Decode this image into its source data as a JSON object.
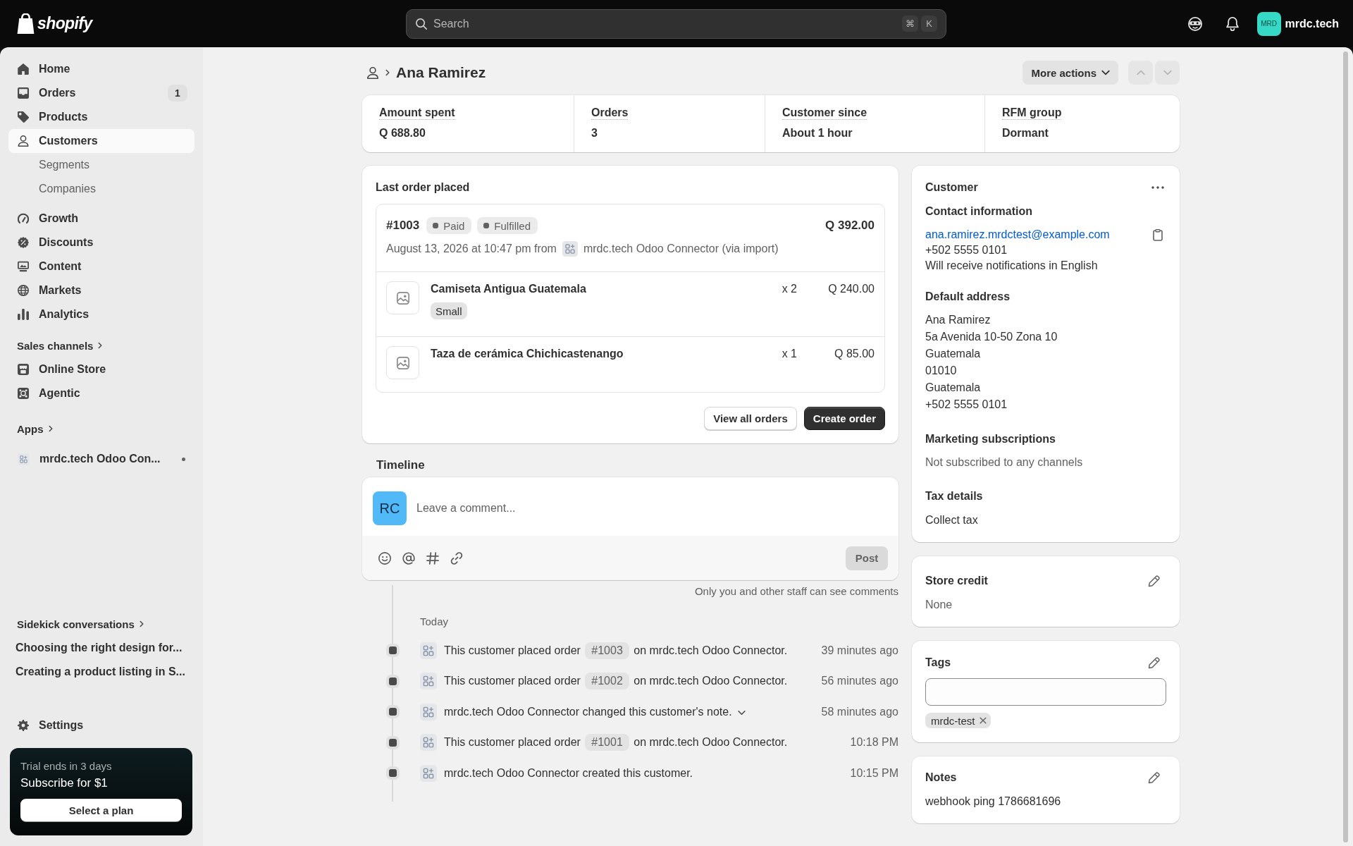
{
  "top_bar": {
    "logo": "shopify",
    "search": {
      "placeholder": "Search",
      "keys": [
        "⌘",
        "K"
      ]
    },
    "store": {
      "avatar": "MRD",
      "name": "mrdc.tech"
    }
  },
  "sidebar": {
    "nav": [
      {
        "label": "Home",
        "selected": false
      },
      {
        "label": "Orders",
        "selected": false,
        "badge": "1"
      },
      {
        "label": "Products",
        "selected": false
      },
      {
        "label": "Customers",
        "selected": true,
        "children": [
          {
            "label": "Segments",
            "selected": false
          },
          {
            "label": "Companies",
            "selected": false
          }
        ]
      }
    ],
    "nav_2": [
      {
        "label": "Growth",
        "selected": false
      },
      {
        "label": "Discounts",
        "selected": false
      },
      {
        "label": "Content",
        "selected": false
      },
      {
        "label": "Markets",
        "selected": false
      },
      {
        "label": "Analytics",
        "selected": false
      }
    ],
    "sales_channels": {
      "title": "Sales channels",
      "items": [
        {
          "label": "Online Store",
          "selected": false
        },
        {
          "label": "Agentic",
          "selected": false
        }
      ]
    },
    "apps": {
      "title": "Apps",
      "items": [
        {
          "label": "mrdc.tech Odoo Con...",
          "selected": false
        }
      ]
    },
    "sidekick": {
      "title": "Sidekick conversations",
      "items": [
        {
          "label": "Choosing the right design for...",
          "selected": false
        },
        {
          "label": "Creating a product listing in S...",
          "selected": false
        }
      ]
    },
    "settings": {
      "label": "Settings",
      "selected": false
    },
    "trial": {
      "note": "Trial ends in 3 days",
      "title": "Subscribe for $1",
      "button": "Select a plan"
    }
  },
  "page": {
    "title": "Ana Ramirez",
    "more_actions": "More actions",
    "pager": [
      {
        "kind": "previous",
        "disabled": true
      },
      {
        "kind": "next",
        "disabled": true
      }
    ]
  },
  "stats": [
    {
      "label": "Amount spent",
      "value": "Q 688.80"
    },
    {
      "label": "Orders",
      "value": "3"
    },
    {
      "label": "Customer since",
      "value": "About 1 hour"
    },
    {
      "label": "RFM group",
      "value": "Dormant"
    }
  ],
  "last_order": {
    "title": "Last order placed",
    "number": "#1003",
    "statuses": [
      "Paid",
      "Fulfilled"
    ],
    "total": "Q 392.00",
    "date": "August 13, 2026 at 10:47 pm from",
    "source": "mrdc.tech Odoo Connector (via import)",
    "line_items": [
      {
        "name": "Camiseta Antigua Guatemala",
        "variant": "Small",
        "quantity": "x 2",
        "price": "Q 240.00"
      },
      {
        "name": "Taza de cerámica Chichicastenango",
        "quantity": "x 1",
        "price": "Q 85.00"
      }
    ],
    "buttons": [
      {
        "label": "View all orders",
        "kind": "secondary"
      },
      {
        "label": "Create order",
        "kind": "primary"
      }
    ]
  },
  "timeline": {
    "title": "Timeline",
    "comment": {
      "avatar": "RC",
      "placeholder": "Leave a comment...",
      "post": {
        "label": "Post",
        "disabled": true
      }
    },
    "privacy_note": "Only you and other staff can see comments",
    "day": "Today",
    "events": [
      {
        "kind": "order",
        "before": "This customer placed order",
        "order": "#1003",
        "after": "on mrdc.tech Odoo Connector.",
        "expandable": false,
        "time": "39 minutes ago"
      },
      {
        "kind": "order",
        "before": "This customer placed order",
        "order": "#1002",
        "after": "on mrdc.tech Odoo Connector.",
        "expandable": false,
        "time": "56 minutes ago"
      },
      {
        "kind": "message",
        "text": "mrdc.tech Odoo Connector changed this customer's note.",
        "expandable": true,
        "time": "58 minutes ago"
      },
      {
        "kind": "order",
        "before": "This customer placed order",
        "order": "#1001",
        "after": "on mrdc.tech Odoo Connector.",
        "expandable": false,
        "time": "10:18 PM"
      },
      {
        "kind": "message",
        "text": "mrdc.tech Odoo Connector created this customer.",
        "expandable": false,
        "time": "10:15 PM"
      }
    ]
  },
  "customer": {
    "title": "Customer",
    "contact": {
      "title": "Contact information",
      "email": "ana.ramirez.mrdctest@example.com",
      "phone": "+502 5555 0101",
      "language": "Will receive notifications in English"
    },
    "address": {
      "title": "Default address",
      "lines": [
        "Ana Ramirez",
        "5a Avenida 10-50 Zona 10",
        "Guatemala",
        "01010",
        "Guatemala",
        "+502 5555 0101"
      ]
    },
    "marketing": {
      "title": "Marketing subscriptions",
      "value": "Not subscribed to any channels"
    },
    "tax": {
      "title": "Tax details",
      "value": "Collect tax"
    }
  },
  "store_credit": {
    "title": "Store credit",
    "value": "None"
  },
  "tags": {
    "title": "Tags",
    "tags": [
      "mrdc-test"
    ]
  },
  "notes": {
    "title": "Notes",
    "text": "webhook ping 1786681696"
  }
}
